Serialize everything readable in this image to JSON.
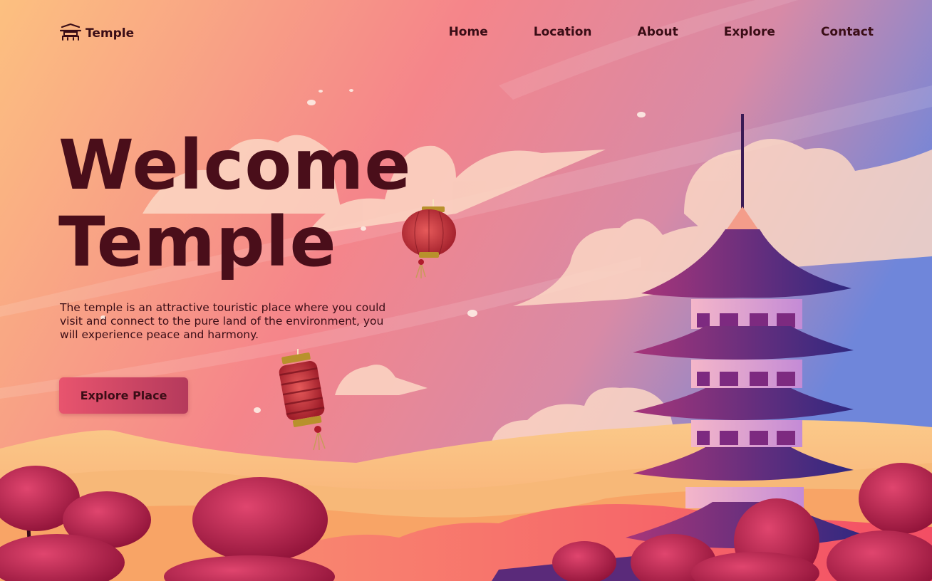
{
  "brand": {
    "name": "Temple",
    "icon": "temple-icon"
  },
  "nav": {
    "items": [
      "Home",
      "Location",
      "About",
      "Explore",
      "Contact"
    ]
  },
  "hero": {
    "title_line1": "Welcome",
    "title_line2": "Temple",
    "description": "The temple is an attractive touristic place where you could visit and connect to the pure land of the environment, you will experience peace and harmony.",
    "cta_label": "Explore Place"
  },
  "colors": {
    "sky_left": "#fbb07a",
    "sky_mid": "#f5808a",
    "sky_right": "#6f86da",
    "title": "#4a0e1a",
    "text": "#3a0d16",
    "cta": "#e8546e",
    "pagoda_roof": "#6b2a7a",
    "tree": "#c21d4e"
  }
}
